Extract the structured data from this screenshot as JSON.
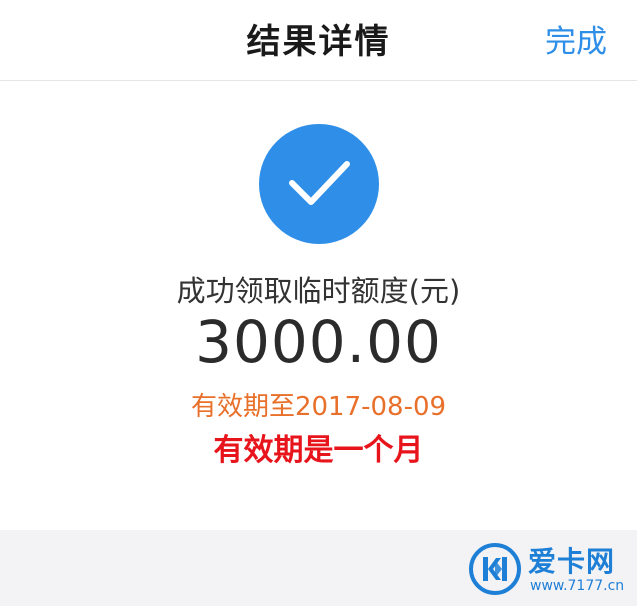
{
  "navbar": {
    "title": "结果详情",
    "done_label": "完成"
  },
  "result": {
    "status_icon": "check-icon",
    "label": "成功领取临时额度(元)",
    "amount": "3000.00",
    "validity": "有效期至2017-08-09",
    "annotation": "有效期是一个月"
  },
  "watermark": {
    "logo_icon": "kk-logo-icon",
    "name": "爱卡网",
    "url": "www.7177.cn"
  },
  "colors": {
    "accent": "#2f8fe8",
    "validity": "#e8702a",
    "annotation": "#e8141c",
    "footer_bg": "#f3f3f5"
  }
}
